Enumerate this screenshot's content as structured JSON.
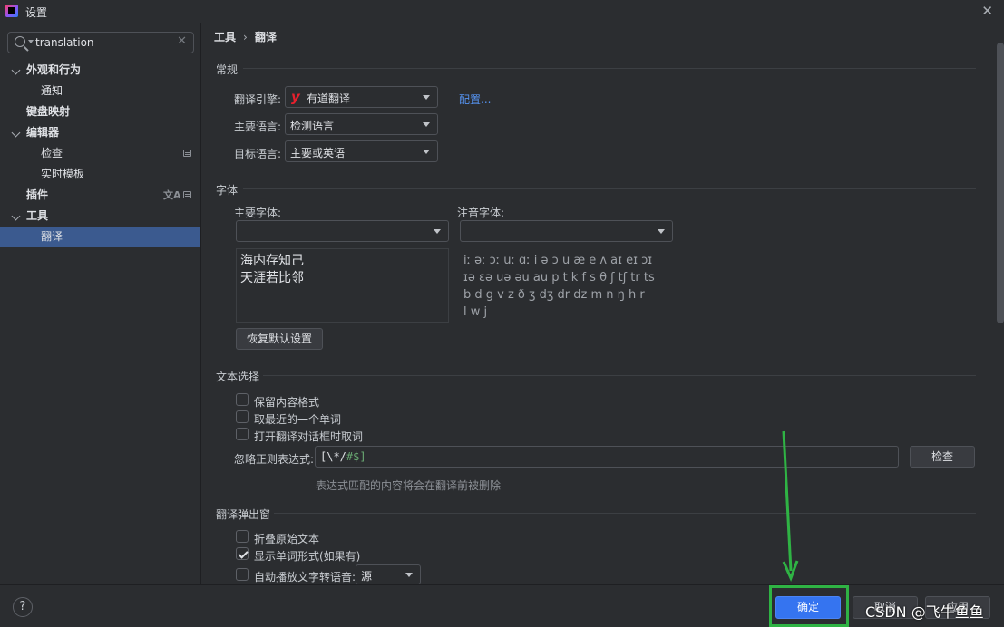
{
  "window": {
    "title": "设置"
  },
  "search": {
    "value": "translation"
  },
  "sidebar": {
    "items": [
      {
        "label": "外观和行为"
      },
      {
        "label": "通知"
      },
      {
        "label": "键盘映射"
      },
      {
        "label": "编辑器"
      },
      {
        "label": "检查"
      },
      {
        "label": "实时模板"
      },
      {
        "label": "插件"
      },
      {
        "label": "工具"
      },
      {
        "label": "翻译"
      }
    ]
  },
  "breadcrumb": {
    "parent": "工具",
    "current": "翻译"
  },
  "general": {
    "section_title": "常规",
    "engine_label": "翻译引擎:",
    "engine_value": "有道翻译",
    "configure_link": "配置...",
    "primary_lang_label": "主要语言:",
    "primary_lang_value": "检测语言",
    "target_lang_label": "目标语言:",
    "target_lang_value": "主要或英语"
  },
  "font": {
    "section_title": "字体",
    "primary_font_label": "主要字体:",
    "phonetic_font_label": "注音字体:",
    "preview_lines": [
      "海内存知己",
      "天涯若比邻"
    ],
    "phonetic_lines": [
      "iː əː ɔː uː ɑː i ə ɔ u æ e ʌ aɪ eɪ ɔɪ",
      "ɪə ɛə uə əu au p t k f s θ ʃ tʃ tr ts",
      "b d g v z ð ʒ dʒ dr dz m n ŋ h r",
      "l w j"
    ],
    "reset_button": "恢复默认设置"
  },
  "text_selection": {
    "section_title": "文本选择",
    "keep_format": "保留内容格式",
    "take_nearest_word": "取最近的一个单词",
    "take_word_on_open": "打开翻译对话框时取词",
    "ignore_regex_label": "忽略正则表达式:",
    "ignore_regex_value_a": "[\\*/",
    "ignore_regex_value_b": "#$]",
    "check_button": "检查",
    "regex_hint": "表达式匹配的内容将会在翻译前被删除"
  },
  "popup": {
    "section_title": "翻译弹出窗",
    "fold_original": "折叠原始文本",
    "show_word_forms": "显示单词形式(如果有)",
    "auto_tts": "自动播放文字转语音:",
    "tts_source_value": "源"
  },
  "footer": {
    "help": "?",
    "ok_button": "确定",
    "cancel_button": "取消",
    "apply_button": "应用"
  },
  "watermark": "CSDN @飞牛鱼鱼",
  "colors": {
    "accent": "#3574f0",
    "selection": "#3b5a8f",
    "annotation": "#2fb344",
    "link": "#5694f2"
  }
}
